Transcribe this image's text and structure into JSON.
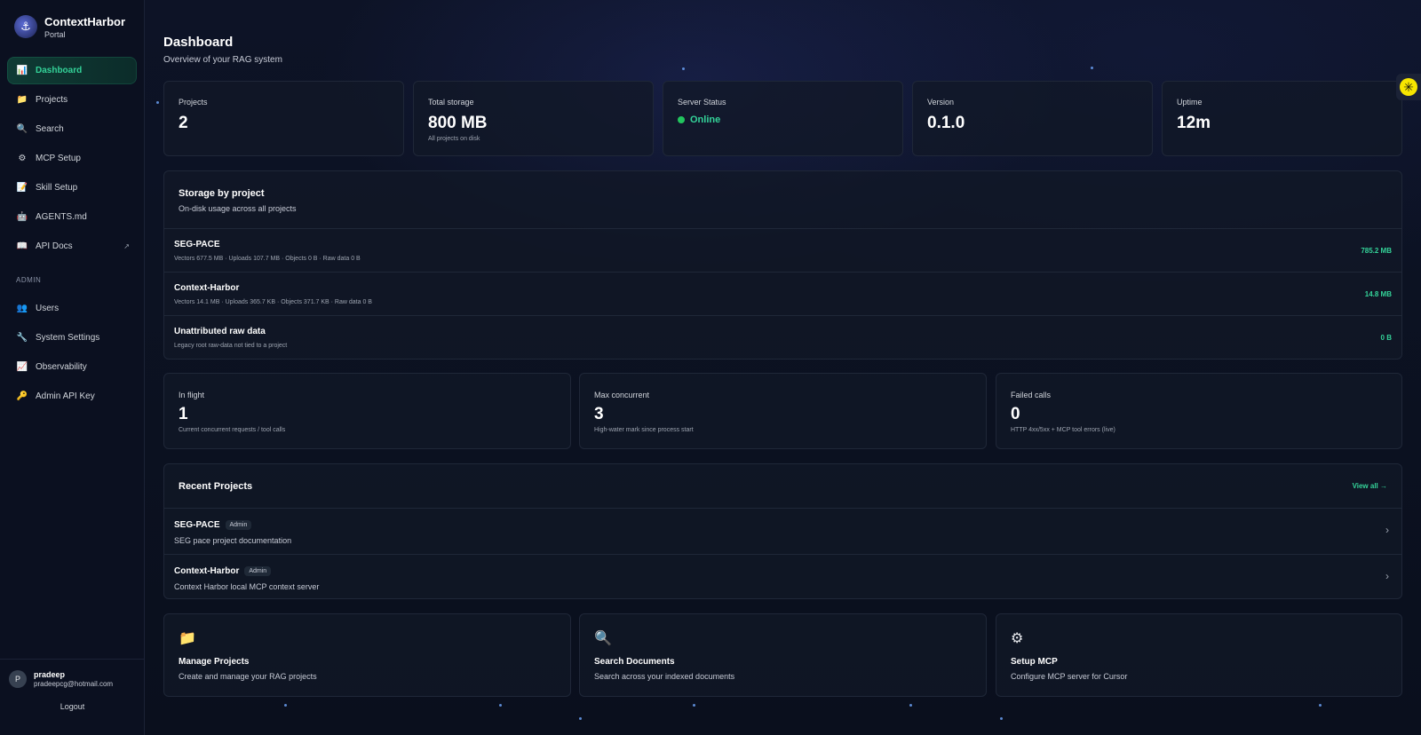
{
  "brand": {
    "name": "ContextHarbor",
    "subtitle": "Portal"
  },
  "nav": {
    "items": [
      {
        "label": "Dashboard",
        "icon": "chart-icon",
        "glyph": "📊"
      },
      {
        "label": "Projects",
        "icon": "folder-icon",
        "glyph": "📁"
      },
      {
        "label": "Search",
        "icon": "search-icon",
        "glyph": "🔍"
      },
      {
        "label": "MCP Setup",
        "icon": "gear-icon",
        "glyph": "⚙"
      },
      {
        "label": "Skill Setup",
        "icon": "memo-icon",
        "glyph": "📝"
      },
      {
        "label": "AGENTS.md",
        "icon": "robot-icon",
        "glyph": "🤖"
      },
      {
        "label": "API Docs",
        "icon": "book-icon",
        "glyph": "📖",
        "external": "↗"
      }
    ],
    "admin_section": "ADMIN",
    "admin_items": [
      {
        "label": "Users",
        "icon": "users-icon",
        "glyph": "👥"
      },
      {
        "label": "System Settings",
        "icon": "wrench-icon",
        "glyph": "🔧"
      },
      {
        "label": "Observability",
        "icon": "trend-icon",
        "glyph": "📈"
      },
      {
        "label": "Admin API Key",
        "icon": "key-icon",
        "glyph": "🔑"
      }
    ]
  },
  "user": {
    "initial": "P",
    "name": "pradeep",
    "email": "pradeepcg@hotmail.com",
    "logout": "Logout"
  },
  "page": {
    "title": "Dashboard",
    "subtitle": "Overview of your RAG system"
  },
  "stats": {
    "projects": {
      "label": "Projects",
      "value": "2"
    },
    "storage": {
      "label": "Total storage",
      "value": "800 MB",
      "note": "All projects on disk"
    },
    "server": {
      "label": "Server Status",
      "value": "Online"
    },
    "version": {
      "label": "Version",
      "value": "0.1.0"
    },
    "uptime": {
      "label": "Uptime",
      "value": "12m"
    }
  },
  "storage_by_project": {
    "title": "Storage by project",
    "subtitle": "On-disk usage across all projects",
    "rows": [
      {
        "name": "SEG-PACE",
        "detail": "Vectors 677.5 MB · Uploads 107.7 MB · Objects 0 B · Raw data 0 B",
        "value": "785.2 MB"
      },
      {
        "name": "Context-Harbor",
        "detail": "Vectors 14.1 MB · Uploads 365.7 KB · Objects 371.7 KB · Raw data 0 B",
        "value": "14.8 MB"
      },
      {
        "name": "Unattributed raw data",
        "detail": "Legacy root raw-data not tied to a project",
        "value": "0 B"
      }
    ]
  },
  "metrics": {
    "in_flight": {
      "label": "In flight",
      "value": "1",
      "note": "Current concurrent requests / tool calls"
    },
    "max_concurrent": {
      "label": "Max concurrent",
      "value": "3",
      "note": "High-water mark since process start"
    },
    "failed_calls": {
      "label": "Failed calls",
      "value": "0",
      "note": "HTTP 4xx/5xx + MCP tool errors (live)"
    }
  },
  "recent_projects": {
    "title": "Recent Projects",
    "view_all": "View all →",
    "items": [
      {
        "name": "SEG-PACE",
        "badge": "Admin",
        "description": "SEG pace project documentation"
      },
      {
        "name": "Context-Harbor",
        "badge": "Admin",
        "description": "Context Harbor local MCP context server"
      }
    ]
  },
  "actions": [
    {
      "icon": "folder-icon",
      "glyph": "📁",
      "title": "Manage Projects",
      "subtitle": "Create and manage your RAG projects"
    },
    {
      "icon": "magnifier-icon",
      "glyph": "🔍",
      "title": "Search Documents",
      "subtitle": "Search across your indexed documents"
    },
    {
      "icon": "gear-icon",
      "glyph": "⚙",
      "title": "Setup MCP",
      "subtitle": "Configure MCP server for Cursor"
    }
  ],
  "colors": {
    "accent": "#34d399",
    "background": "#0a0f1d",
    "card": "#111827"
  }
}
